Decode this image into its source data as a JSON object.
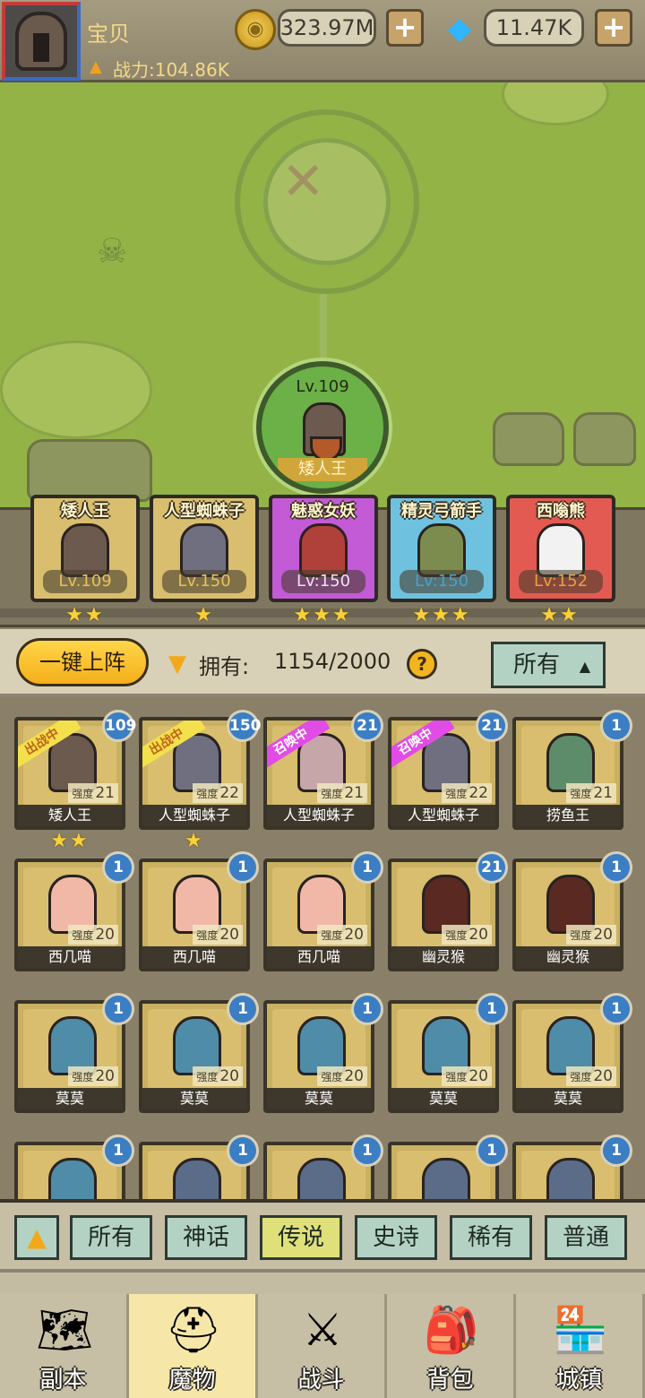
{
  "player": {
    "name": "宝贝",
    "power_label": "战力:104.86K"
  },
  "currency": {
    "gold": "323.97M",
    "gems": "11.47K"
  },
  "leader": {
    "level": "Lv.109",
    "name": "矮人王"
  },
  "team": [
    {
      "name": "矮人王",
      "level": "Lv.109",
      "stars": "★★",
      "color": "#d8be6e",
      "char_color": "#6c5a4e"
    },
    {
      "name": "人型蜘蛛子",
      "level": "Lv.150",
      "stars": "★",
      "color": "#d8be6e",
      "char_color": "#6f6f80"
    },
    {
      "name": "魅惑女妖",
      "level": "Lv:150",
      "stars": "★★★",
      "color": "#c35ad6",
      "char_color": "#b0403a"
    },
    {
      "name": "精灵弓箭手",
      "level": "Lv:150",
      "stars": "★★★",
      "color": "#6ec2df",
      "char_color": "#7b8c4e"
    },
    {
      "name": "西嗡熊",
      "level": "Lv:152",
      "stars": "★★",
      "color": "#e35a52",
      "char_color": "#f2f2f2"
    }
  ],
  "controls": {
    "deploy_label": "一键上阵",
    "own_label": "拥有:",
    "own_value": "1154/2000",
    "help": "?",
    "filter_label": "所有"
  },
  "monsters": [
    {
      "name": "矮人王",
      "strength": "21",
      "badge": "109",
      "ribbon": "出战中",
      "ribbon_style": "gold",
      "stars": "★★",
      "char_color": "#6c5a4e"
    },
    {
      "name": "人型蜘蛛子",
      "strength": "22",
      "badge": "150",
      "ribbon": "出战中",
      "ribbon_style": "gold",
      "stars": "★",
      "char_color": "#6f6f80"
    },
    {
      "name": "人型蜘蛛子",
      "strength": "21",
      "badge": "21",
      "ribbon": "召唤中",
      "ribbon_style": "pink",
      "stars": "",
      "char_color": "#c6a6a8"
    },
    {
      "name": "人型蜘蛛子",
      "strength": "22",
      "badge": "21",
      "ribbon": "召唤中",
      "ribbon_style": "pink",
      "stars": "",
      "char_color": "#6f6f80"
    },
    {
      "name": "捞鱼王",
      "strength": "21",
      "badge": "1",
      "ribbon": "",
      "ribbon_style": "",
      "stars": "",
      "char_color": "#5d8c6a"
    },
    {
      "name": "西几喵",
      "strength": "20",
      "badge": "1",
      "ribbon": "",
      "ribbon_style": "",
      "stars": "",
      "char_color": "#f1b8a8"
    },
    {
      "name": "西几喵",
      "strength": "20",
      "badge": "1",
      "ribbon": "",
      "ribbon_style": "",
      "stars": "",
      "char_color": "#f1b8a8"
    },
    {
      "name": "西几喵",
      "strength": "20",
      "badge": "1",
      "ribbon": "",
      "ribbon_style": "",
      "stars": "",
      "char_color": "#f1b8a8"
    },
    {
      "name": "幽灵猴",
      "strength": "20",
      "badge": "21",
      "ribbon": "",
      "ribbon_style": "",
      "stars": "",
      "char_color": "#5a2a22"
    },
    {
      "name": "幽灵猴",
      "strength": "20",
      "badge": "1",
      "ribbon": "",
      "ribbon_style": "",
      "stars": "",
      "char_color": "#5a2a22"
    },
    {
      "name": "莫莫",
      "strength": "20",
      "badge": "1",
      "ribbon": "",
      "ribbon_style": "",
      "stars": "",
      "char_color": "#4f8ca8"
    },
    {
      "name": "莫莫",
      "strength": "20",
      "badge": "1",
      "ribbon": "",
      "ribbon_style": "",
      "stars": "",
      "char_color": "#4f8ca8"
    },
    {
      "name": "莫莫",
      "strength": "20",
      "badge": "1",
      "ribbon": "",
      "ribbon_style": "",
      "stars": "",
      "char_color": "#4f8ca8"
    },
    {
      "name": "莫莫",
      "strength": "20",
      "badge": "1",
      "ribbon": "",
      "ribbon_style": "",
      "stars": "",
      "char_color": "#4f8ca8"
    },
    {
      "name": "莫莫",
      "strength": "20",
      "badge": "1",
      "ribbon": "",
      "ribbon_style": "",
      "stars": "",
      "char_color": "#4f8ca8"
    },
    {
      "name": "",
      "strength": "",
      "badge": "1",
      "ribbon": "",
      "ribbon_style": "",
      "stars": "",
      "char_color": "#4f8ca8"
    },
    {
      "name": "",
      "strength": "",
      "badge": "1",
      "ribbon": "",
      "ribbon_style": "",
      "stars": "",
      "char_color": "#5a6c88"
    },
    {
      "name": "",
      "strength": "",
      "badge": "1",
      "ribbon": "",
      "ribbon_style": "",
      "stars": "",
      "char_color": "#5a6c88"
    },
    {
      "name": "",
      "strength": "",
      "badge": "1",
      "ribbon": "",
      "ribbon_style": "",
      "stars": "",
      "char_color": "#5a6c88"
    },
    {
      "name": "",
      "strength": "",
      "badge": "1",
      "ribbon": "",
      "ribbon_style": "",
      "stars": "",
      "char_color": "#5a6c88"
    }
  ],
  "strength_label": "强度",
  "rarity_filters": [
    "所有",
    "神话",
    "传说",
    "史诗",
    "稀有",
    "普通"
  ],
  "rarity_active": "传说",
  "nav": [
    {
      "label": "副本",
      "icon": "map-icon"
    },
    {
      "label": "魔物",
      "icon": "monster-helmet-icon"
    },
    {
      "label": "战斗",
      "icon": "crossed-swords-icon"
    },
    {
      "label": "背包",
      "icon": "backpack-icon"
    },
    {
      "label": "城镇",
      "icon": "town-shop-icon"
    }
  ],
  "nav_active": "魔物"
}
